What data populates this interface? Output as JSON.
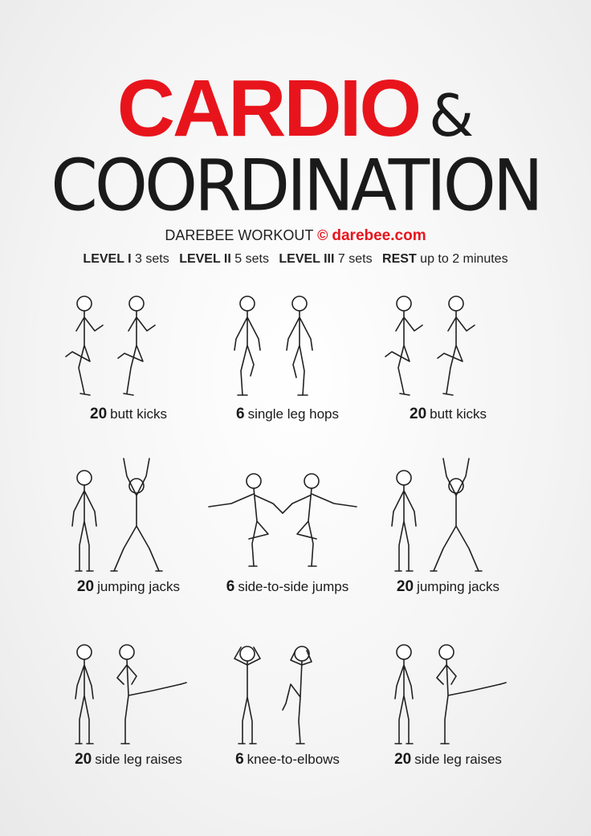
{
  "title": {
    "red": "CARDIO",
    "amp": "&",
    "sub": "COORDINATION"
  },
  "brand": {
    "prefix": "DAREBEE WORKOUT",
    "copyright": "©",
    "site": "darebee.com"
  },
  "levels": [
    {
      "name": "LEVEL I",
      "value": "3 sets"
    },
    {
      "name": "LEVEL II",
      "value": "5 sets"
    },
    {
      "name": "LEVEL III",
      "value": "7 sets"
    },
    {
      "name": "REST",
      "value": "up to 2 minutes"
    }
  ],
  "exercises": [
    {
      "count": "20",
      "name": "butt kicks",
      "icon": "butt-kicks-figure"
    },
    {
      "count": "6",
      "name": "single leg hops",
      "icon": "single-leg-hops-figure"
    },
    {
      "count": "20",
      "name": "butt kicks",
      "icon": "butt-kicks-figure"
    },
    {
      "count": "20",
      "name": "jumping jacks",
      "icon": "jumping-jacks-figure"
    },
    {
      "count": "6",
      "name": "side-to-side jumps",
      "icon": "side-to-side-jumps-figure"
    },
    {
      "count": "20",
      "name": "jumping jacks",
      "icon": "jumping-jacks-figure"
    },
    {
      "count": "20",
      "name": "side leg raises",
      "icon": "side-leg-raises-figure"
    },
    {
      "count": "6",
      "name": "knee-to-elbows",
      "icon": "knee-to-elbows-figure"
    },
    {
      "count": "20",
      "name": "side leg raises",
      "icon": "side-leg-raises-figure"
    }
  ],
  "colors": {
    "accent": "#e8141c",
    "text": "#1a1a1a",
    "background": "#f4f4f4"
  }
}
